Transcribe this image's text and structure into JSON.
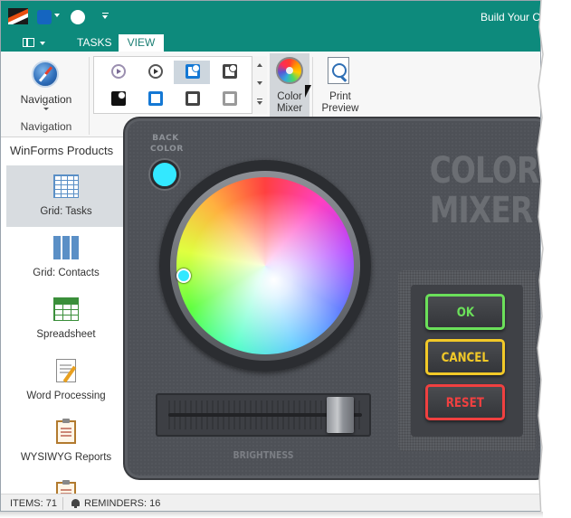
{
  "window": {
    "title": "Build Your C"
  },
  "ribbon": {
    "tabs": [
      {
        "label": "TASKS"
      },
      {
        "label": "VIEW"
      }
    ],
    "navigation": {
      "button_label": "Navigation",
      "group_caption": "Navigation"
    },
    "gallery": {
      "items": [
        {
          "icon": "skin-circle-icon"
        },
        {
          "icon": "skin-circle-dark-icon"
        },
        {
          "icon": "office-blue-badge-icon",
          "selected": true
        },
        {
          "icon": "office-badge-icon"
        },
        {
          "icon": "office-black-badge-icon"
        },
        {
          "icon": "office-blue-icon"
        },
        {
          "icon": "office-icon"
        },
        {
          "icon": "office-grey-icon"
        }
      ]
    },
    "color_mixer": {
      "label_line1": "Color",
      "label_line2": "Mixer"
    },
    "print_preview": {
      "label_line1": "Print",
      "label_line2": "Preview"
    }
  },
  "sidebar": {
    "title": "WinForms Products",
    "items": [
      {
        "label": "Grid: Tasks",
        "icon": "grid-icon",
        "selected": true
      },
      {
        "label": "Grid: Contacts",
        "icon": "cards-icon"
      },
      {
        "label": "Spreadsheet",
        "icon": "spreadsheet-icon"
      },
      {
        "label": "Word Processing",
        "icon": "document-edit-icon"
      },
      {
        "label": "WYSIWYG Reports",
        "icon": "clipboard-icon"
      }
    ]
  },
  "mixer": {
    "back_color_line1": "BACK",
    "back_color_line2": "COLOR",
    "back_color_value": "#33e8ff",
    "title_line1": "COLOR",
    "title_line2": "MIXER",
    "brightness_label": "BRIGHTNESS",
    "brightness_level": 0.93,
    "ok_label": "OK",
    "cancel_label": "CANCEL",
    "reset_label": "RESET"
  },
  "statusbar": {
    "items": "ITEMS: 71",
    "reminders": "REMINDERS: 16"
  },
  "colors": {
    "title_bar": "#0d8a7c",
    "ok": "#6be05a",
    "cancel": "#f2c928",
    "reset": "#f04040"
  }
}
